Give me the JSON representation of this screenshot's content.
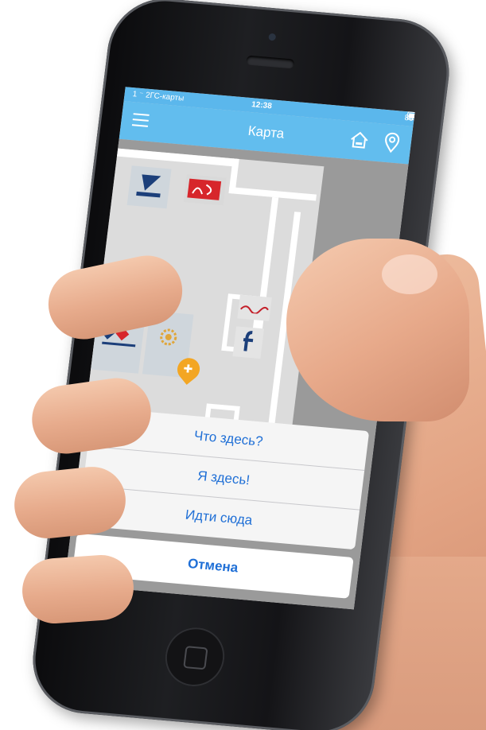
{
  "status_bar": {
    "carrier": "1 ⁻ 2ГС-карты",
    "time": "12:38",
    "battery": "88%"
  },
  "nav_bar": {
    "title": "Карта"
  },
  "action_sheet": {
    "options": [
      "Что здесь?",
      "Я здесь!",
      "Идти сюда"
    ],
    "cancel": "Отмена"
  },
  "icons": [
    "menu-icon",
    "home-icon",
    "location-pin-icon",
    "map-marker-icon"
  ],
  "colors": {
    "nav_bar": "#62bdee",
    "sheet_text": "#1f6fd6",
    "map_marker": "#f3a623"
  }
}
